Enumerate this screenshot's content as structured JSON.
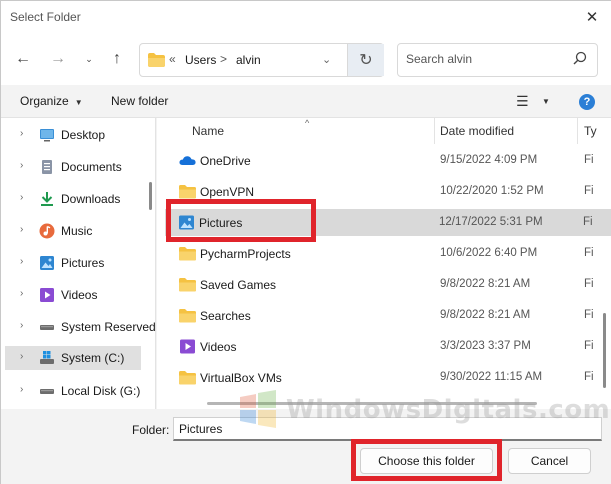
{
  "window": {
    "title": "Select Folder"
  },
  "nav": {
    "back_icon": "arrow-left-icon",
    "forward_icon": "arrow-right-icon",
    "recent_icon": "chevron-down-icon",
    "up_icon": "arrow-up-icon"
  },
  "address": {
    "overflow": "«",
    "crumbs": [
      "Users",
      "alvin"
    ],
    "separator": ">"
  },
  "search": {
    "placeholder": "Search alvin"
  },
  "toolbar": {
    "organize": "Organize",
    "new_folder": "New folder"
  },
  "sidebar": {
    "items": [
      {
        "label": "Desktop",
        "icon": "desktop-icon"
      },
      {
        "label": "Documents",
        "icon": "documents-icon"
      },
      {
        "label": "Downloads",
        "icon": "downloads-icon"
      },
      {
        "label": "Music",
        "icon": "music-icon"
      },
      {
        "label": "Pictures",
        "icon": "pictures-icon"
      },
      {
        "label": "Videos",
        "icon": "videos-icon"
      },
      {
        "label": "System Reserved",
        "icon": "drive-icon"
      },
      {
        "label": "System (C:)",
        "icon": "windows-drive-icon",
        "selected": true
      },
      {
        "label": "Local Disk (G:)",
        "icon": "drive-icon"
      }
    ]
  },
  "columns": {
    "name": "Name",
    "date": "Date modified",
    "type": "Ty"
  },
  "files": [
    {
      "name": "OneDrive",
      "date": "9/15/2022 4:09 PM",
      "type": "Fi",
      "icon": "onedrive-icon"
    },
    {
      "name": "OpenVPN",
      "date": "10/22/2020 1:52 PM",
      "type": "Fi",
      "icon": "folder-icon"
    },
    {
      "name": "Pictures",
      "date": "12/17/2022 5:31 PM",
      "type": "Fi",
      "icon": "pictures-icon",
      "selected": true
    },
    {
      "name": "PycharmProjects",
      "date": "10/6/2022 6:40 PM",
      "type": "Fi",
      "icon": "folder-icon"
    },
    {
      "name": "Saved Games",
      "date": "9/8/2022 8:21 AM",
      "type": "Fi",
      "icon": "folder-icon"
    },
    {
      "name": "Searches",
      "date": "9/8/2022 8:21 AM",
      "type": "Fi",
      "icon": "folder-icon"
    },
    {
      "name": "Videos",
      "date": "3/3/2023 3:37 PM",
      "type": "Fi",
      "icon": "videos-icon"
    },
    {
      "name": "VirtualBox VMs",
      "date": "9/30/2022 11:15 AM",
      "type": "Fi",
      "icon": "folder-icon"
    }
  ],
  "footer": {
    "folder_label": "Folder:",
    "folder_value": "Pictures",
    "choose_button": "Choose this folder",
    "cancel_button": "Cancel"
  },
  "watermark": {
    "text": "WindowsDigitals.com"
  },
  "colors": {
    "highlight": "#e0242b",
    "accent": "#2b7fd6",
    "folder": "#f5c242"
  }
}
